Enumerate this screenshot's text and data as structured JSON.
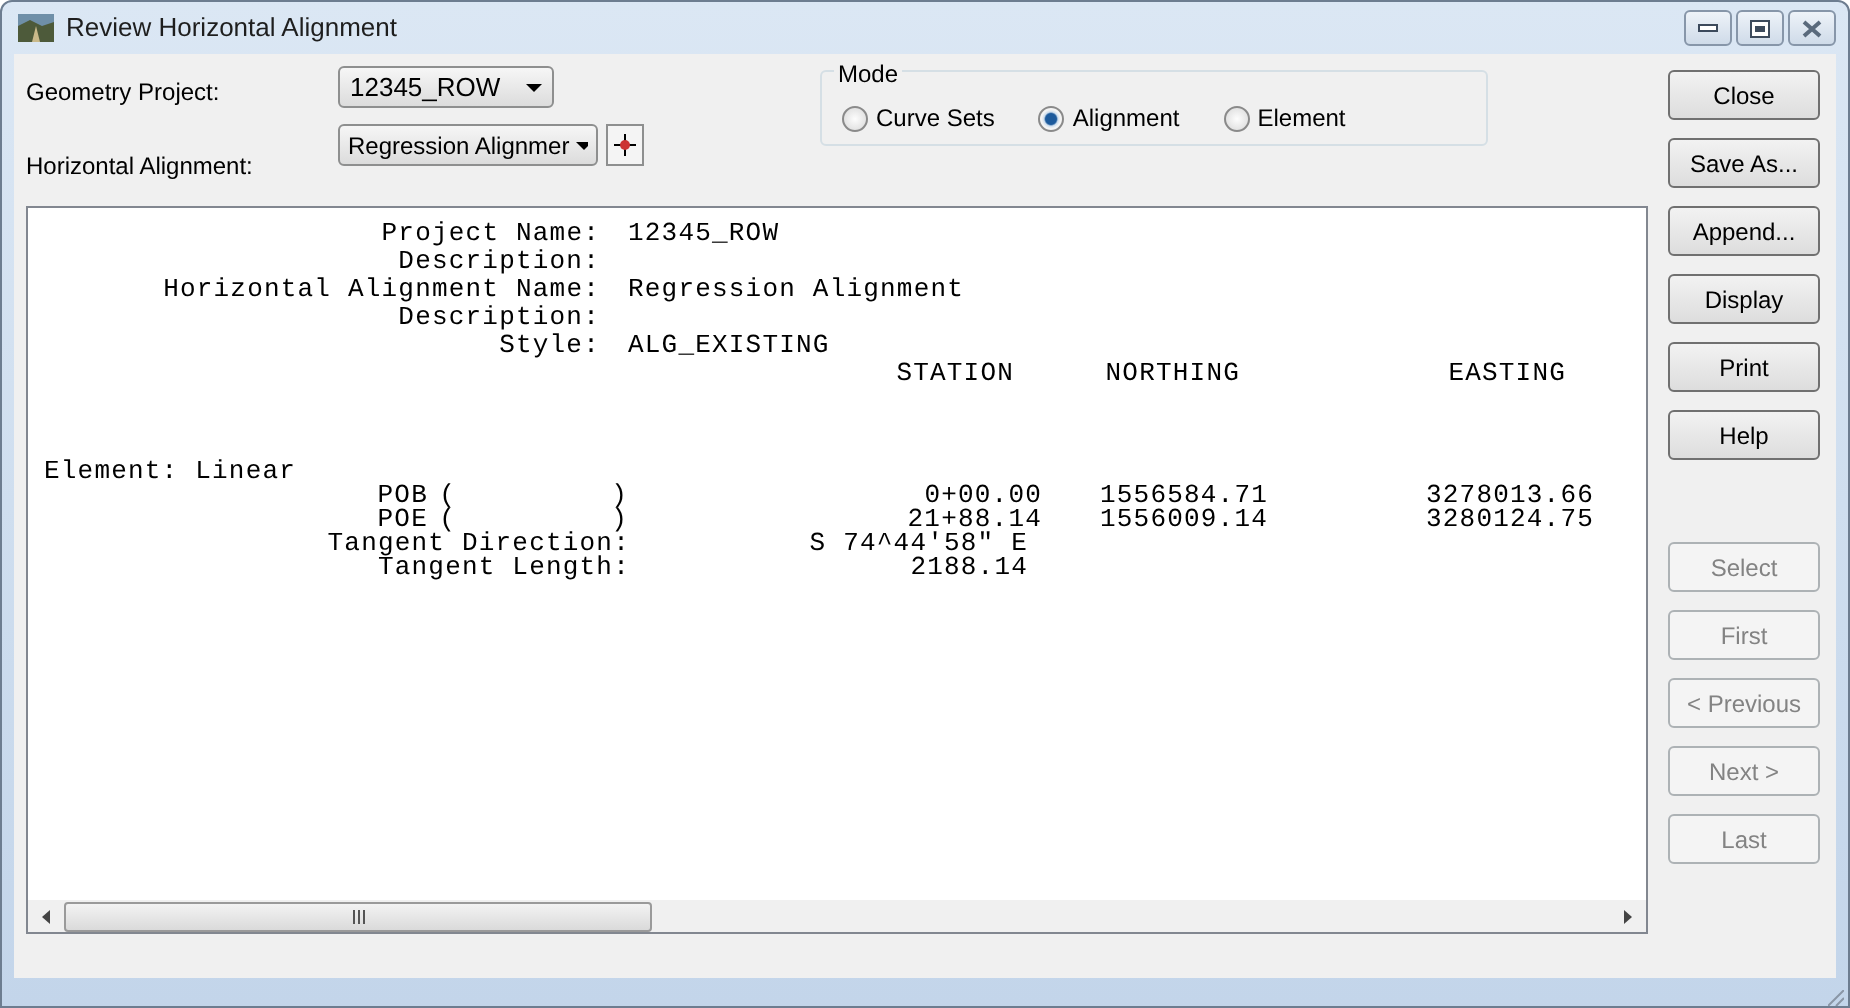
{
  "window": {
    "title": "Review Horizontal Alignment"
  },
  "geometry_project": {
    "label": "Geometry Project:",
    "value": "12345_ROW"
  },
  "horizontal_alignment": {
    "label": "Horizontal Alignment:",
    "value": "Regression Alignmer"
  },
  "mode": {
    "label": "Mode",
    "options": [
      {
        "label": "Curve Sets",
        "selected": false
      },
      {
        "label": "Alignment",
        "selected": true
      },
      {
        "label": "Element",
        "selected": false
      }
    ]
  },
  "report": {
    "fields": [
      {
        "label": "Project Name:",
        "value": "12345_ROW"
      },
      {
        "label": "Description:"
      },
      {
        "label": "Horizontal Alignment Name:",
        "value": "Regression Alignment"
      },
      {
        "label": "Description:"
      },
      {
        "label": "Style:",
        "value": "ALG_EXISTING"
      }
    ],
    "columns": [
      "STATION",
      "NORTHING",
      "EASTING"
    ],
    "element": "Element: Linear",
    "points": [
      {
        "name": "POB",
        "open": "(",
        "close": ")",
        "station": "0+00.00",
        "northing": "1556584.71",
        "easting": "3278013.66"
      },
      {
        "name": "POE",
        "open": "(",
        "close": ")",
        "station": "21+88.14",
        "northing": "1556009.14",
        "easting": "3280124.75"
      }
    ],
    "tangent": [
      {
        "label": "Tangent Direction:",
        "value": "S 74^44'58\" E"
      },
      {
        "label": "Tangent Length:",
        "value": "2188.14"
      }
    ]
  },
  "buttons": [
    {
      "label": "Close",
      "disabled": false
    },
    {
      "label": "Save As...",
      "disabled": false
    },
    {
      "label": "Append...",
      "disabled": false
    },
    {
      "label": "Display",
      "disabled": false
    },
    {
      "label": "Print",
      "disabled": false
    },
    {
      "label": "Help",
      "disabled": false
    },
    {
      "label": "Select",
      "disabled": true
    },
    {
      "label": "First",
      "disabled": true
    },
    {
      "label": "< Previous",
      "disabled": true
    },
    {
      "label": "Next >",
      "disabled": true
    },
    {
      "label": "Last",
      "disabled": true
    }
  ]
}
